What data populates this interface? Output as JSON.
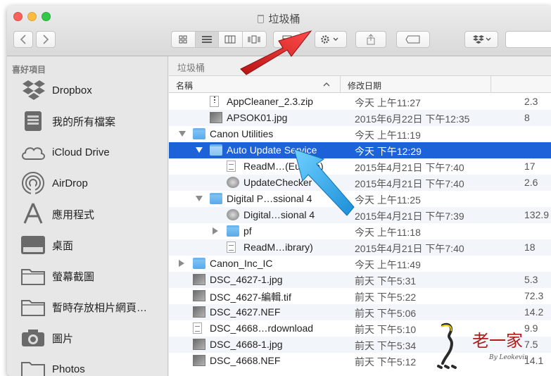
{
  "window": {
    "title": "垃圾桶"
  },
  "toolbar": {
    "back_icon": "chevron-left-icon",
    "forward_icon": "chevron-right-icon",
    "views": [
      "icon-view-icon",
      "list-view-icon",
      "column-view-icon",
      "coverflow-view-icon"
    ],
    "active_view": "list-view-icon"
  },
  "sidebar": {
    "header": "喜好項目",
    "items": [
      {
        "label": "Dropbox",
        "icon": "dropbox-icon"
      },
      {
        "label": "我的所有檔案",
        "icon": "all-files-icon"
      },
      {
        "label": "iCloud Drive",
        "icon": "cloud-icon"
      },
      {
        "label": "AirDrop",
        "icon": "airdrop-icon"
      },
      {
        "label": "應用程式",
        "icon": "applications-icon"
      },
      {
        "label": "桌面",
        "icon": "desktop-icon"
      },
      {
        "label": "螢幕截圖",
        "icon": "folder-icon"
      },
      {
        "label": "暫時存放相片網頁…",
        "icon": "folder-icon"
      },
      {
        "label": "圖片",
        "icon": "camera-icon"
      },
      {
        "label": "Photos",
        "icon": "folder-icon"
      }
    ]
  },
  "pathbar": {
    "label": "垃圾桶"
  },
  "columns": {
    "name": "名稱",
    "date": "修改日期"
  },
  "files": [
    {
      "name": "AppCleaner_2.3.zip",
      "date": "今天 上午11:27",
      "size": "2.3",
      "indent": 1,
      "disclosure": "none",
      "icon": "zip"
    },
    {
      "name": "APSOK01.jpg",
      "date": "2015年6月22日 下午12:35",
      "size": "8",
      "indent": 1,
      "disclosure": "none",
      "icon": "img"
    },
    {
      "name": "Canon Utilities",
      "date": "今天 上午11:19",
      "size": "",
      "indent": 0,
      "disclosure": "open",
      "icon": "folder"
    },
    {
      "name": "Auto Update Service",
      "date": "今天 下午12:29",
      "size": "",
      "indent": 1,
      "disclosure": "open",
      "icon": "folder",
      "selected": true
    },
    {
      "name": "ReadM…(Europe)",
      "date": "2015年4月21日 下午7:40",
      "size": "17",
      "indent": 2,
      "disclosure": "none",
      "icon": "doc"
    },
    {
      "name": "UpdateChecker",
      "date": "2015年4月21日 下午7:40",
      "size": "2.6",
      "indent": 2,
      "disclosure": "none",
      "icon": "app"
    },
    {
      "name": "Digital P…ssional 4",
      "date": "今天 上午11:25",
      "size": "",
      "indent": 1,
      "disclosure": "open",
      "icon": "folder"
    },
    {
      "name": "Digital…sional 4",
      "date": "2015年4月21日 下午7:39",
      "size": "132.9",
      "indent": 2,
      "disclosure": "none",
      "icon": "app"
    },
    {
      "name": "pf",
      "date": "今天 上午11:18",
      "size": "",
      "indent": 2,
      "disclosure": "closed",
      "icon": "folder"
    },
    {
      "name": "ReadM…ibrary)",
      "date": "2015年4月21日 下午7:40",
      "size": "18",
      "indent": 2,
      "disclosure": "none",
      "icon": "doc"
    },
    {
      "name": "Canon_Inc_IC",
      "date": "今天 上午11:49",
      "size": "",
      "indent": 0,
      "disclosure": "closed",
      "icon": "folder"
    },
    {
      "name": "DSC_4627-1.jpg",
      "date": "前天 下午5:31",
      "size": "5.3",
      "indent": 0,
      "disclosure": "none",
      "icon": "img"
    },
    {
      "name": "DSC_4627-編輯.tif",
      "date": "前天 下午5:22",
      "size": "72.3",
      "indent": 0,
      "disclosure": "none",
      "icon": "img"
    },
    {
      "name": "DSC_4627.NEF",
      "date": "前天 下午5:06",
      "size": "14.2",
      "indent": 0,
      "disclosure": "none",
      "icon": "img"
    },
    {
      "name": "DSC_4668…rdownload",
      "date": "前天 下午5:10",
      "size": "9.9",
      "indent": 0,
      "disclosure": "none",
      "icon": "doc"
    },
    {
      "name": "DSC_4668-1.jpg",
      "date": "前天 下午5:34",
      "size": "7.5",
      "indent": 0,
      "disclosure": "none",
      "icon": "img"
    },
    {
      "name": "DSC_4668.NEF",
      "date": "前天 下午5:12",
      "size": "14.1",
      "indent": 0,
      "disclosure": "none",
      "icon": "img"
    }
  ],
  "watermark": {
    "text": "老一家",
    "byline": "By Leokevin"
  },
  "colors": {
    "selection": "#1d62d8",
    "arrow_red": "#e02424",
    "arrow_blue": "#2aa3e6",
    "folder": "#6bb5ee"
  }
}
